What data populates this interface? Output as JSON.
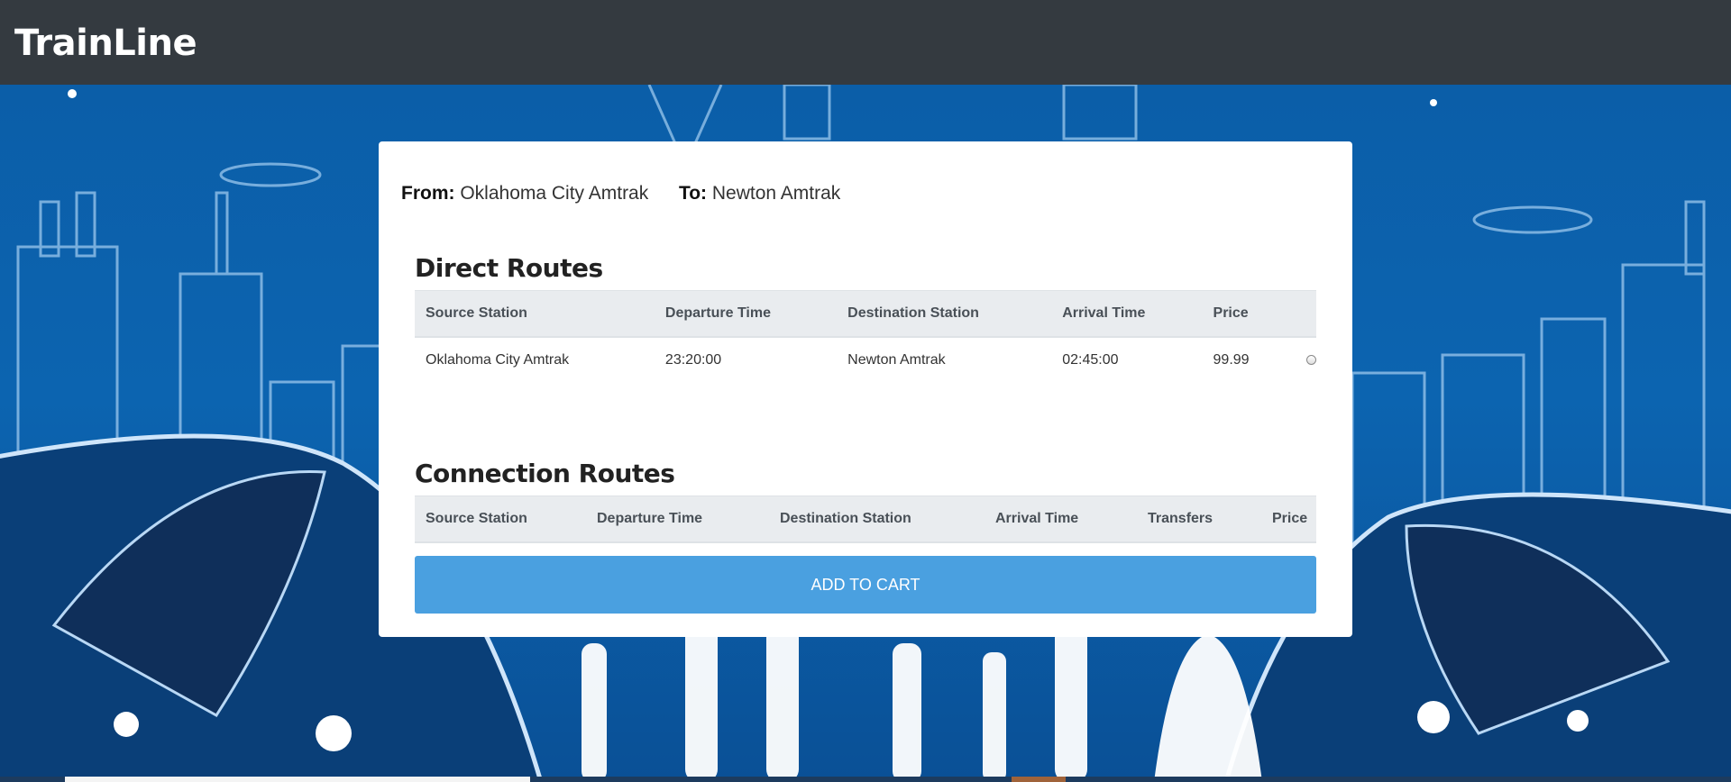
{
  "navbar": {
    "brand": "TrainLine"
  },
  "search": {
    "from_label": "From:",
    "from_value": "Oklahoma City Amtrak",
    "to_label": "To:",
    "to_value": "Newton Amtrak"
  },
  "direct_routes": {
    "title": "Direct Routes",
    "columns": [
      "Source Station",
      "Departure Time",
      "Destination Station",
      "Arrival Time",
      "Price"
    ],
    "rows": [
      {
        "source": "Oklahoma City Amtrak",
        "departure": "23:20:00",
        "destination": "Newton Amtrak",
        "arrival": "02:45:00",
        "price": "99.99",
        "selected": false
      }
    ]
  },
  "connection_routes": {
    "title": "Connection Routes",
    "columns": [
      "Source Station",
      "Departure Time",
      "Destination Station",
      "Arrival Time",
      "Transfers",
      "Price"
    ],
    "rows": []
  },
  "actions": {
    "add_to_cart_label": "ADD TO CART"
  },
  "colors": {
    "navbar": "#343a40",
    "background": "#0c64b0",
    "button": "#4aa0e0",
    "table_header": "#e9ecef"
  }
}
